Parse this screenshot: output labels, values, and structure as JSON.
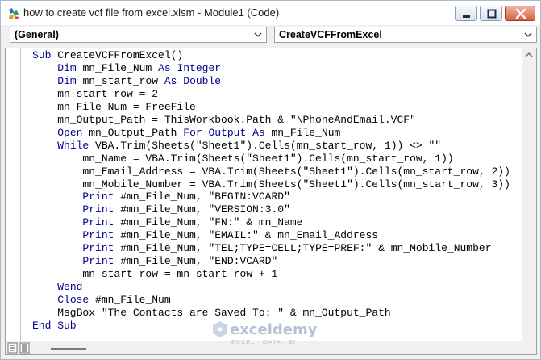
{
  "window": {
    "title": "how to create vcf file from excel.xlsm - Module1 (Code)",
    "accent": "#1a3f8f"
  },
  "combos": {
    "object": "(General)",
    "procedure": "CreateVCFFromExcel"
  },
  "code_lines": [
    [
      {
        "t": "Sub ",
        "k": true
      },
      {
        "t": "CreateVCFFromExcel()"
      }
    ],
    [
      {
        "t": "    "
      },
      {
        "t": "Dim ",
        "k": true
      },
      {
        "t": "mn_File_Num "
      },
      {
        "t": "As Integer",
        "k": true
      }
    ],
    [
      {
        "t": "    "
      },
      {
        "t": "Dim ",
        "k": true
      },
      {
        "t": "mn_start_row "
      },
      {
        "t": "As Double",
        "k": true
      }
    ],
    [
      {
        "t": "    mn_start_row = 2"
      }
    ],
    [
      {
        "t": "    mn_File_Num = FreeFile"
      }
    ],
    [
      {
        "t": "    mn_Output_Path = ThisWorkbook.Path & \"\\PhoneAndEmail.VCF\""
      }
    ],
    [
      {
        "t": "    "
      },
      {
        "t": "Open ",
        "k": true
      },
      {
        "t": "mn_Output_Path "
      },
      {
        "t": "For Output As ",
        "k": true
      },
      {
        "t": "mn_File_Num"
      }
    ],
    [
      {
        "t": "    "
      },
      {
        "t": "While ",
        "k": true
      },
      {
        "t": "VBA.Trim(Sheets(\"Sheet1\").Cells(mn_start_row, 1)) <> \"\""
      }
    ],
    [
      {
        "t": "        mn_Name = VBA.Trim(Sheets(\"Sheet1\").Cells(mn_start_row, 1))"
      }
    ],
    [
      {
        "t": "        mn_Email_Address = VBA.Trim(Sheets(\"Sheet1\").Cells(mn_start_row, 2))"
      }
    ],
    [
      {
        "t": "        mn_Mobile_Number = VBA.Trim(Sheets(\"Sheet1\").Cells(mn_start_row, 3))"
      }
    ],
    [
      {
        "t": "        "
      },
      {
        "t": "Print ",
        "k": true
      },
      {
        "t": "#mn_File_Num, \"BEGIN:VCARD\""
      }
    ],
    [
      {
        "t": "        "
      },
      {
        "t": "Print ",
        "k": true
      },
      {
        "t": "#mn_File_Num, \"VERSION:3.0\""
      }
    ],
    [
      {
        "t": "        "
      },
      {
        "t": "Print ",
        "k": true
      },
      {
        "t": "#mn_File_Num, \"FN:\" & mn_Name"
      }
    ],
    [
      {
        "t": "        "
      },
      {
        "t": "Print ",
        "k": true
      },
      {
        "t": "#mn_File_Num, \"EMAIL:\" & mn_Email_Address"
      }
    ],
    [
      {
        "t": "        "
      },
      {
        "t": "Print ",
        "k": true
      },
      {
        "t": "#mn_File_Num, \"TEL;TYPE=CELL;TYPE=PREF:\" & mn_Mobile_Number"
      }
    ],
    [
      {
        "t": "        "
      },
      {
        "t": "Print ",
        "k": true
      },
      {
        "t": "#mn_File_Num, \"END:VCARD\""
      }
    ],
    [
      {
        "t": "        mn_start_row = mn_start_row + 1"
      }
    ],
    [
      {
        "t": "    "
      },
      {
        "t": "Wend",
        "k": true
      }
    ],
    [
      {
        "t": "    "
      },
      {
        "t": "Close ",
        "k": true
      },
      {
        "t": "#mn_File_Num"
      }
    ],
    [
      {
        "t": "    MsgBox \"The Contacts are Saved To: \" & mn_Output_Path"
      }
    ],
    [
      {
        "t": "End Sub",
        "k": true
      }
    ]
  ],
  "code_colors": {
    "keyword": "#00008b",
    "text": "#000000"
  },
  "watermark": {
    "name": "exceldemy",
    "tagline": "EXCEL · DATA · BI"
  }
}
